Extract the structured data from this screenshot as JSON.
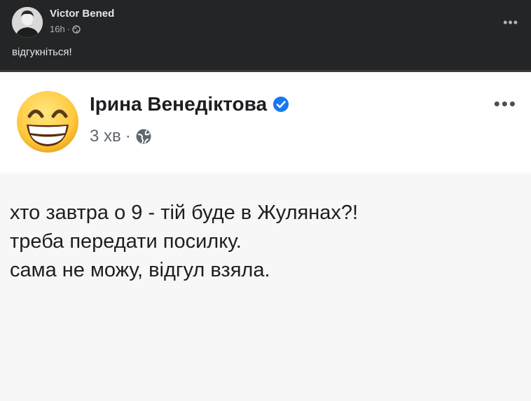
{
  "post": {
    "author": "Victor Bened",
    "time": "16h",
    "meta_separator": "·",
    "audience_icon": "globe-icon",
    "text": "відгукніться!",
    "more_label": "•••"
  },
  "screenshot": {
    "author": "Ірина Венедіктова",
    "verified_icon": "verified-badge-icon",
    "time": "3 хв",
    "meta_separator": "·",
    "audience_icon": "globe-icon",
    "more_label": "•••",
    "lines": [
      "хто завтра о 9 - тій буде в Жулянах?!",
      "треба передати посилку.",
      "сама не можу, відгул взяла."
    ]
  },
  "colors": {
    "dark_background": "#242526",
    "verified_blue": "#1877f2",
    "emoji_yellow": "#ffc83d"
  }
}
